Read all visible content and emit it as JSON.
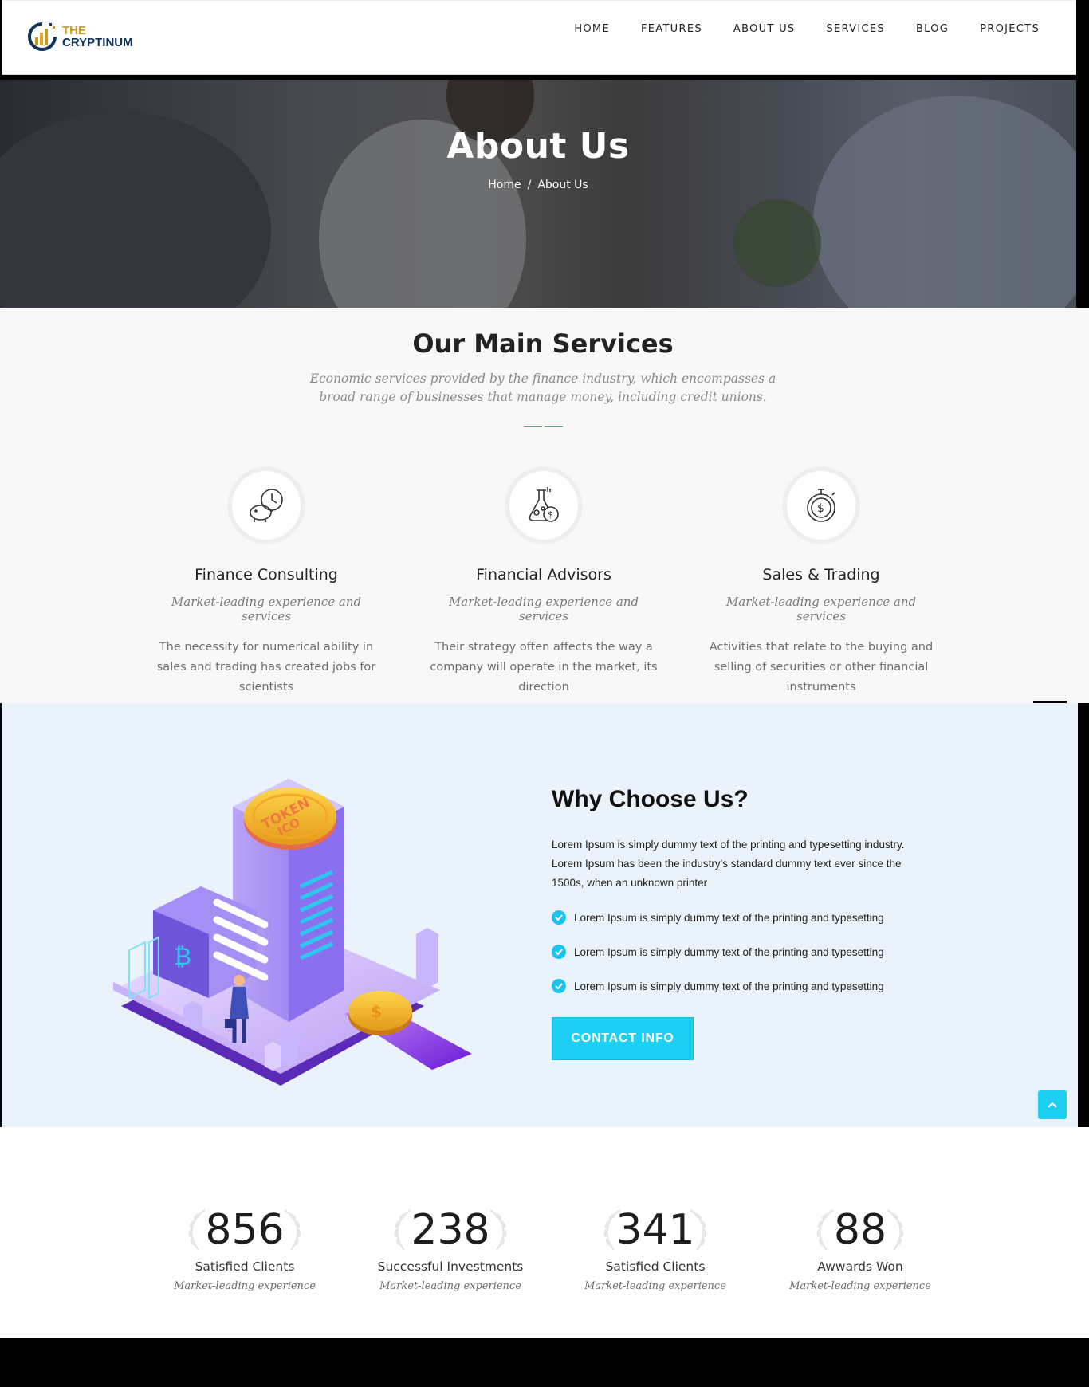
{
  "header": {
    "logo_line1": "THE",
    "logo_line2": "CRYPTINUM",
    "nav": [
      "HOME",
      "FEATURES",
      "ABOUT US",
      "SERVICES",
      "BLOG",
      "PROJECTS"
    ]
  },
  "hero": {
    "title": "About Us",
    "breadcrumb_home": "Home",
    "breadcrumb_sep": "/",
    "breadcrumb_current": "About Us"
  },
  "services": {
    "title": "Our Main Services",
    "subtitle": "Economic services provided by the finance industry, which encompasses a broad range of businesses that manage money, including credit unions.",
    "items": [
      {
        "name": "Finance Consulting",
        "tag": "Market-leading experience and services",
        "desc": "The necessity for numerical ability in sales and trading has created jobs for scientists",
        "icon": "piggy-clock-icon"
      },
      {
        "name": "Financial Advisors",
        "tag": "Market-leading experience and services",
        "desc": "Their strategy often affects the way a company will operate in the market, its direction",
        "icon": "flask-coin-icon"
      },
      {
        "name": "Sales & Trading",
        "tag": "Market-leading experience and services",
        "desc": "Activities that relate to the buying and selling of securities or other financial instruments",
        "icon": "stopwatch-dollar-icon"
      }
    ]
  },
  "why": {
    "title": "Why Choose Us?",
    "text": "Lorem Ipsum is simply dummy text of the printing and typesetting industry. Lorem Ipsum has been the industry's standard dummy text ever since the 1500s, when an unknown printer",
    "checks": [
      "Lorem Ipsum is simply dummy text of the printing and typesetting",
      "Lorem Ipsum is simply dummy text of the printing and typesetting",
      "Lorem Ipsum is simply dummy text of the printing and typesetting"
    ],
    "button": "CONTACT INFO",
    "illustration_labels": {
      "token": "TOKEN",
      "ico": "ICO",
      "bitcoin": "₿",
      "coin": "$"
    }
  },
  "stats": [
    {
      "value": "856",
      "label": "Satisfied Clients",
      "tag": "Market-leading experience"
    },
    {
      "value": "238",
      "label": "Successful Investments",
      "tag": "Market-leading experience"
    },
    {
      "value": "341",
      "label": "Satisfied Clients",
      "tag": "Market-leading experience"
    },
    {
      "value": "88",
      "label": "Awwards Won",
      "tag": "Market-leading experience"
    }
  ],
  "colors": {
    "accent": "#1ccff3",
    "brand_gold": "#c99a21",
    "brand_navy": "#12335a",
    "divider_green": "#3cb371",
    "why_bg": "#eaf2fb"
  }
}
